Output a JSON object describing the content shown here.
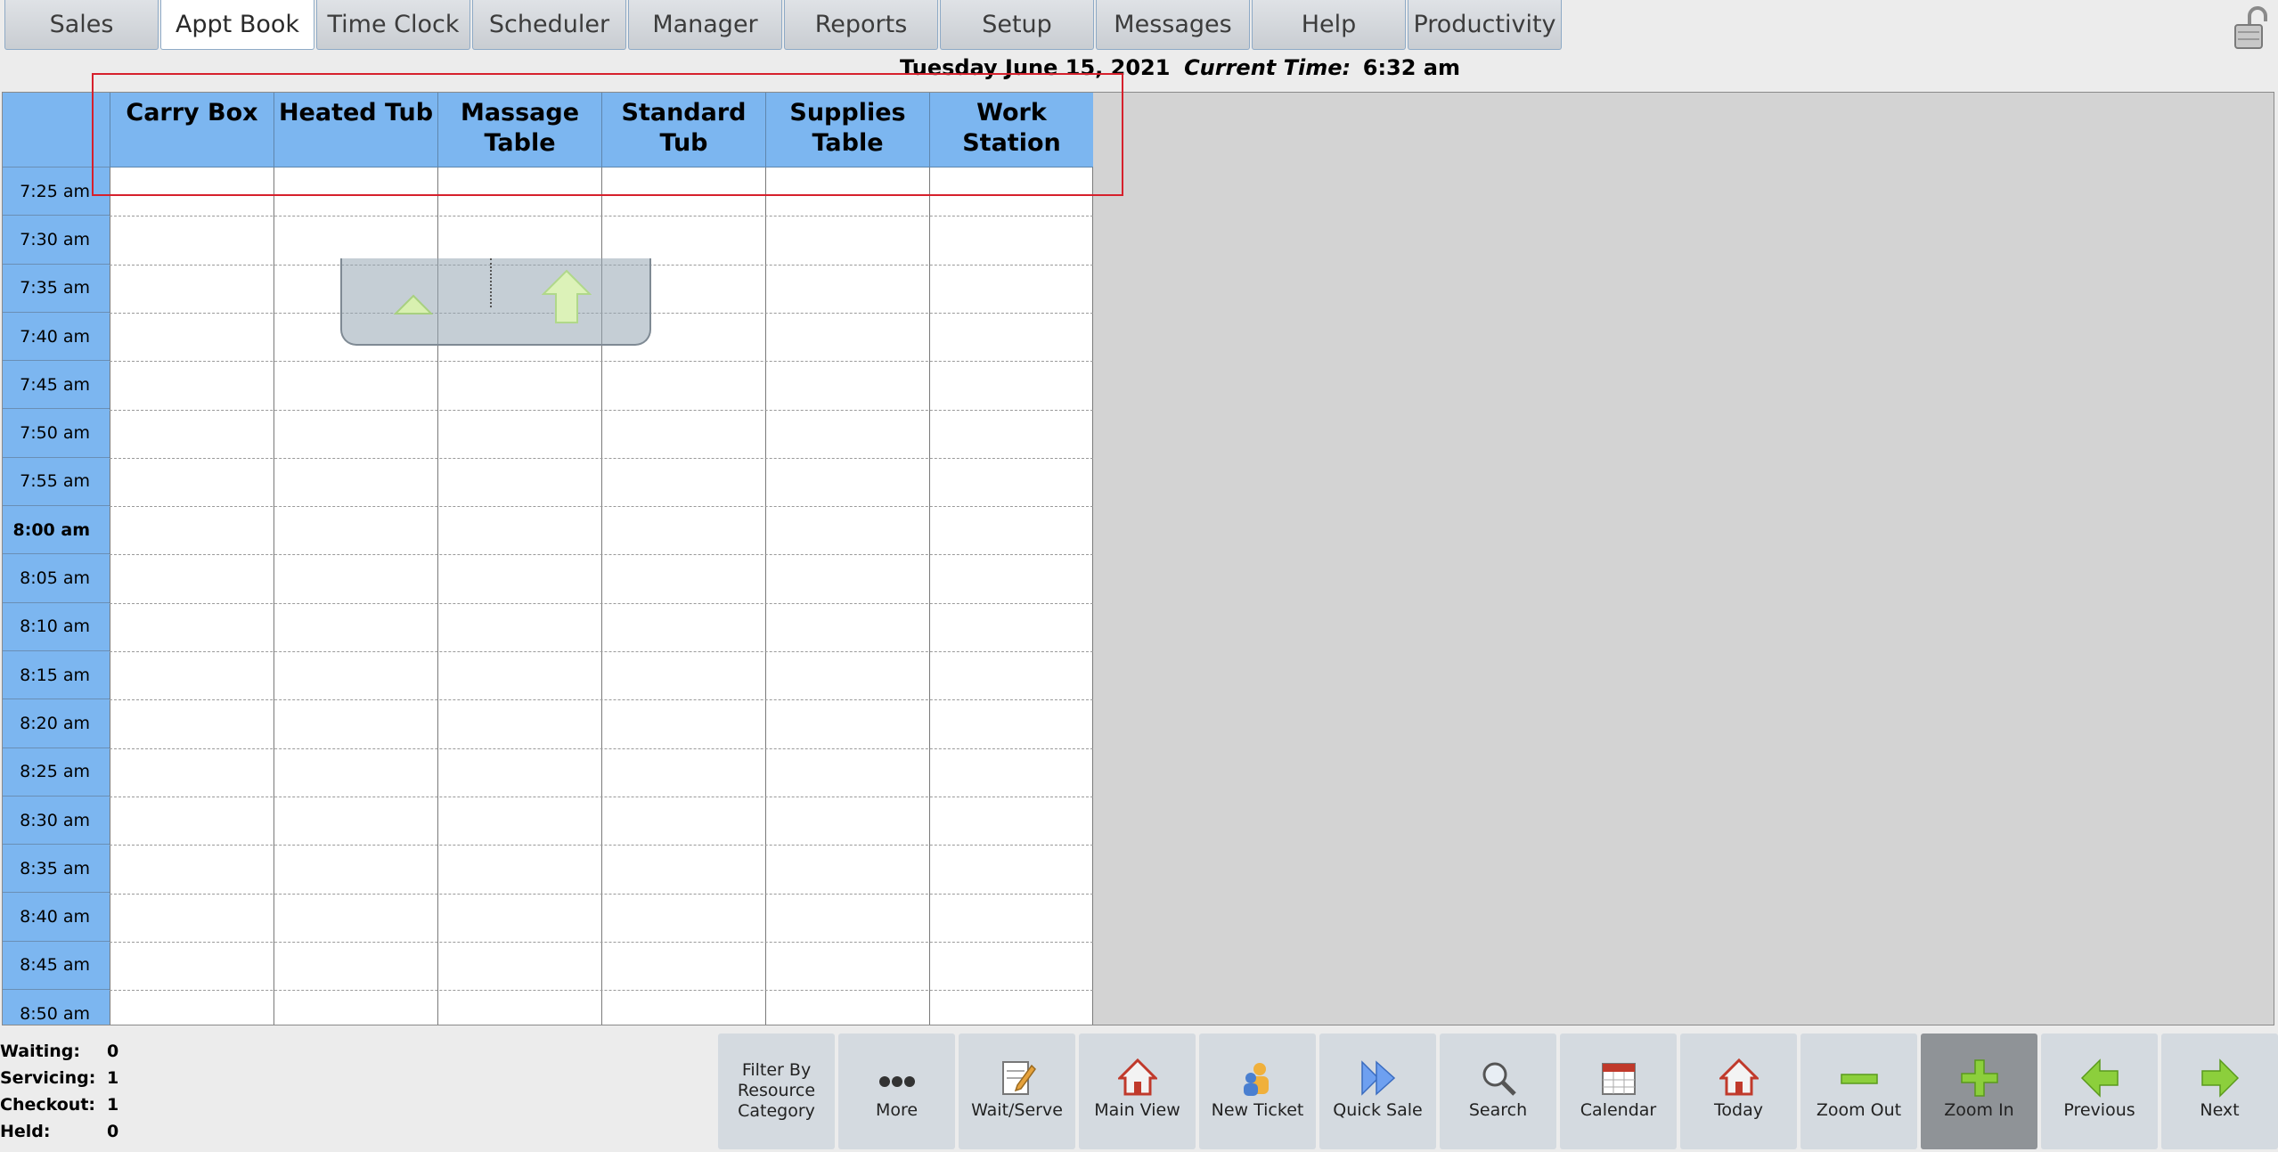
{
  "tabs": [
    "Sales",
    "Appt Book",
    "Time Clock",
    "Scheduler",
    "Manager",
    "Reports",
    "Setup",
    "Messages",
    "Help",
    "Productivity"
  ],
  "active_tab": "Appt Book",
  "date_line": {
    "date": "Tuesday June 15, 2021",
    "current_time_label": "Current Time:",
    "current_time": "6:32 am"
  },
  "resources": [
    "Carry Box",
    "Heated Tub",
    "Massage Table",
    "Standard Tub",
    "Supplies Table",
    "Work Station"
  ],
  "time_slots": [
    "7:25 am",
    "7:30 am",
    "7:35 am",
    "7:40 am",
    "7:45 am",
    "7:50 am",
    "7:55 am",
    "8:00 am",
    "8:05 am",
    "8:10 am",
    "8:15 am",
    "8:20 am",
    "8:25 am",
    "8:30 am",
    "8:35 am",
    "8:40 am",
    "8:45 am",
    "8:50 am"
  ],
  "status": {
    "waiting_label": "Waiting:",
    "waiting": "0",
    "servicing_label": "Servicing:",
    "servicing": "1",
    "checkout_label": "Checkout:",
    "checkout": "1",
    "held_label": "Held:",
    "held": "0"
  },
  "toolbar": [
    {
      "label": "Filter By Resource Category",
      "icon": ""
    },
    {
      "label": "More",
      "icon": "more-dots-icon"
    },
    {
      "label": "Wait/Serve",
      "icon": "notepad-pencil-icon"
    },
    {
      "label": "Main View",
      "icon": "home-icon"
    },
    {
      "label": "New Ticket",
      "icon": "new-person-icon"
    },
    {
      "label": "Quick Sale",
      "icon": "fast-forward-icon"
    },
    {
      "label": "Search",
      "icon": "magnifier-icon"
    },
    {
      "label": "Calendar",
      "icon": "calendar-icon"
    },
    {
      "label": "Today",
      "icon": "home-icon"
    },
    {
      "label": "Zoom Out",
      "icon": "minus-icon"
    },
    {
      "label": "Zoom In",
      "icon": "plus-icon"
    },
    {
      "label": "Previous",
      "icon": "arrow-left-icon"
    },
    {
      "label": "Next",
      "icon": "arrow-right-icon"
    }
  ],
  "active_toolbar_button": "Zoom In",
  "colors": {
    "header_blue": "#7cb6f0",
    "highlight_red": "#d6202c"
  }
}
